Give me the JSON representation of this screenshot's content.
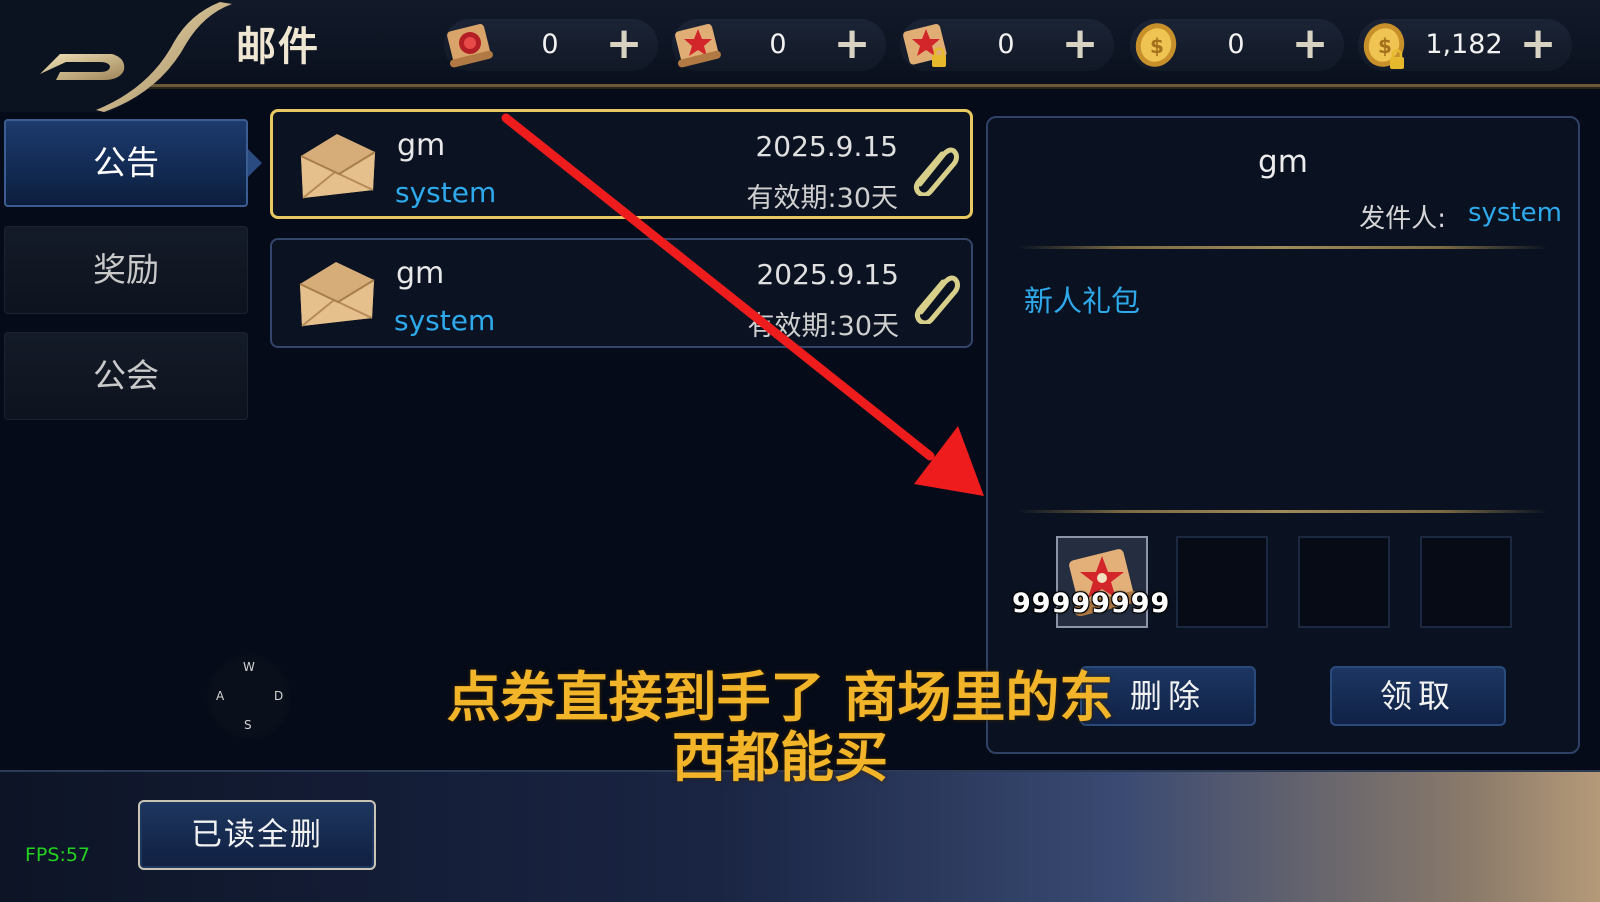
{
  "header": {
    "title": "邮件",
    "currencies": [
      {
        "icon": "red-scroll-coupon-icon",
        "value": "0"
      },
      {
        "icon": "star-scroll-coupon-icon",
        "value": "0"
      },
      {
        "icon": "locked-star-scroll-icon",
        "value": "0"
      },
      {
        "icon": "gold-coin-icon",
        "value": "0"
      },
      {
        "icon": "locked-gold-coin-icon",
        "value": "1,182"
      }
    ],
    "plus_label": "+"
  },
  "sidebar": {
    "tabs": [
      {
        "label": "公告",
        "active": true
      },
      {
        "label": "奖励",
        "active": false
      },
      {
        "label": "公会",
        "active": false
      }
    ]
  },
  "mails": [
    {
      "title": "gm",
      "sender": "system",
      "date": "2025.9.15",
      "expiry": "有效期:30天",
      "selected": true
    },
    {
      "title": "gm",
      "sender": "system",
      "date": "2025.9.15",
      "expiry": "有效期:30天",
      "selected": false
    }
  ],
  "detail": {
    "title": "gm",
    "sender_label": "发件人:",
    "sender": "system",
    "body": "新人礼包",
    "attachment_count": "99999999",
    "delete_label": "删除",
    "claim_label": "领取"
  },
  "bottom": {
    "delete_all_read_label": "已读全删",
    "fps": "FPS:57"
  },
  "joystick": {
    "up": "W",
    "left": "A",
    "right": "D",
    "down": "S"
  },
  "overlay": {
    "caption_line1": "点券直接到手了 商场里的东",
    "caption_line2": "西都能买",
    "arrow_color": "#ee1c1c",
    "caption_color": "#f2b52a"
  }
}
